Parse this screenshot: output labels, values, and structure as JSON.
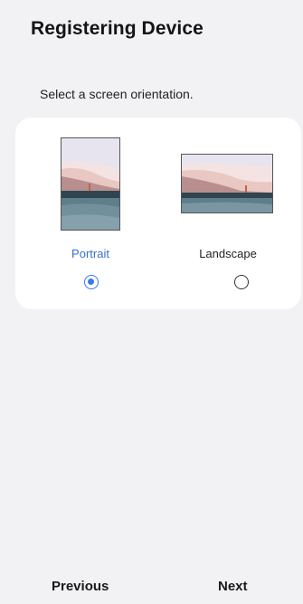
{
  "header": {
    "title": "Registering Device"
  },
  "prompt": {
    "text": "Select a screen orientation."
  },
  "orientation": {
    "selected": "portrait",
    "options": [
      {
        "id": "portrait",
        "label": "Portrait",
        "selected": true
      },
      {
        "id": "landscape",
        "label": "Landscape",
        "selected": false
      }
    ]
  },
  "footer": {
    "previous_label": "Previous",
    "next_label": "Next"
  },
  "colors": {
    "accent": "#3b78e7",
    "selected_label": "#3a6fc4",
    "background": "#f2f2f4",
    "card": "#ffffff"
  }
}
